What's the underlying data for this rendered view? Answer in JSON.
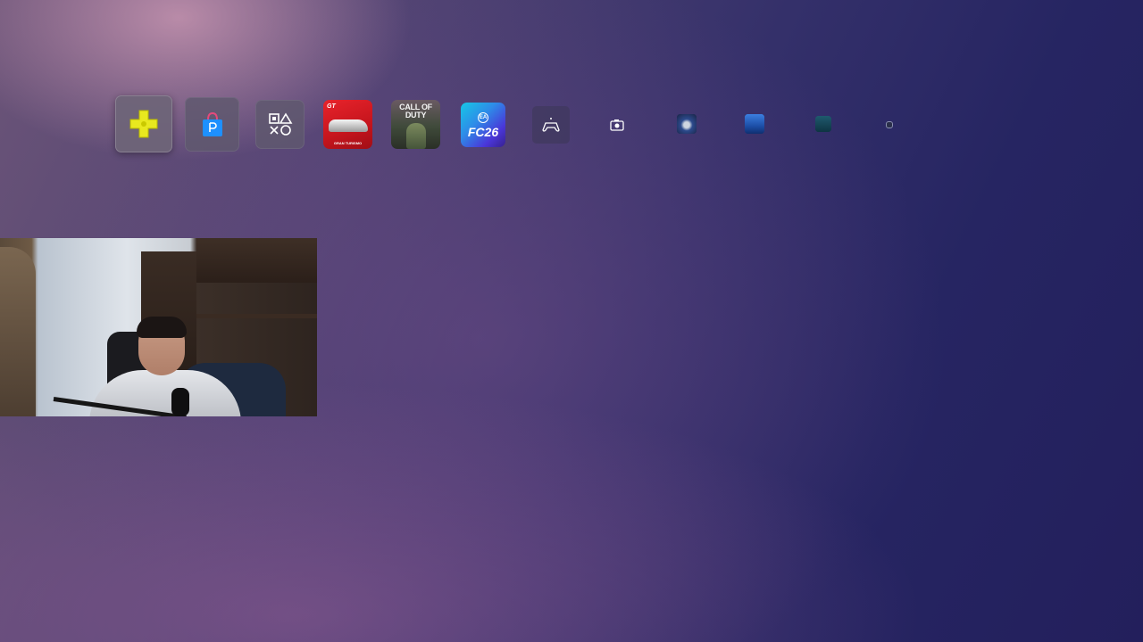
{
  "shelf": {
    "tiles": [
      {
        "id": "ps-plus",
        "icon": "ps-plus-icon",
        "color": "#e8e81f",
        "selected": true
      },
      {
        "id": "ps-store",
        "icon": "ps-store-icon",
        "color": "#1e90ff"
      },
      {
        "id": "game-library",
        "icon": "game-library-icon"
      },
      {
        "id": "gran-turismo",
        "logo_text": "GT",
        "subtitle": "GRAN TURISMO",
        "color": "#e8232b"
      },
      {
        "id": "call-of-duty",
        "title": "CALL OF DUTY"
      },
      {
        "id": "fc26",
        "badge": "EA",
        "title": "FC26"
      },
      {
        "id": "controller",
        "icon": "controller-icon"
      },
      {
        "id": "media-gallery",
        "icon": "camera-icon"
      },
      {
        "id": "app-1",
        "icon": "game-art-icon"
      },
      {
        "id": "app-2",
        "icon": "game-art-icon"
      },
      {
        "id": "app-3",
        "icon": "game-art-icon"
      },
      {
        "id": "app-4",
        "icon": "small-app-icon"
      }
    ]
  },
  "webcam": {
    "description_icon": "webcam-feed"
  }
}
